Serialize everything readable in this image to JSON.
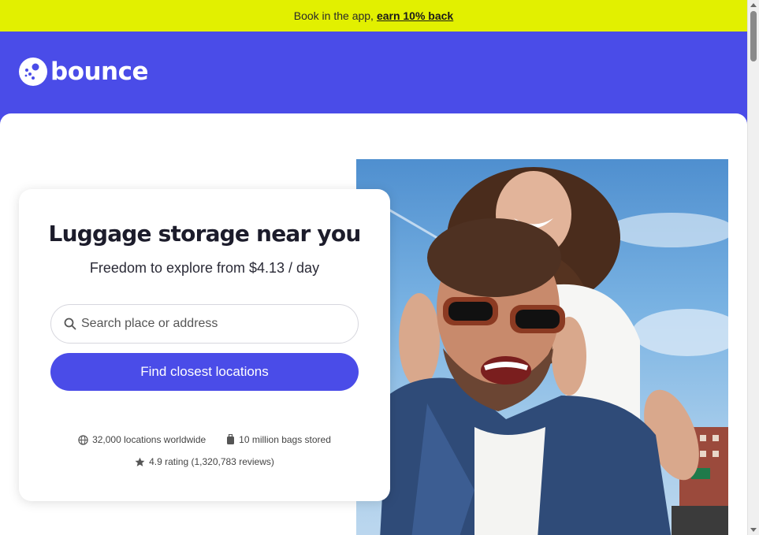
{
  "promo": {
    "text": "Book in the app,",
    "link": "earn 10% back"
  },
  "brand": {
    "name": "bounce",
    "color": "#4a4ce8",
    "accent": "#e2f000"
  },
  "search_card": {
    "title": "Luggage storage near you",
    "subtitle": "Freedom to explore from $4.13 / day",
    "search_placeholder": "Search place or address",
    "search_icon": "search-icon",
    "button_label": "Find closest locations"
  },
  "stats": {
    "locations": "32,000 locations worldwide",
    "bags": "10 million bags stored",
    "rating": "4.9 rating (1,320,783 reviews)",
    "icons": [
      "globe-icon",
      "luggage-icon",
      "star-icon"
    ]
  }
}
